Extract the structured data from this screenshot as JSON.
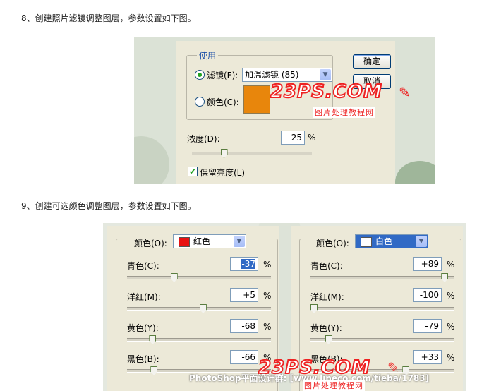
{
  "step8": {
    "text": "8、创建照片滤镜调整图层，参数设置如下图。",
    "group_label": "使用",
    "filter_label": "滤镜(F):",
    "filter_value": "加温滤镜 (85)",
    "color_label": "颜色(C):",
    "ok_label": "确定",
    "cancel_label": "取消",
    "density_label": "浓度(D):",
    "density_value": "25",
    "density_unit": "%",
    "density_level": 25,
    "preserve_label": "保留亮度(L)",
    "preserve_checked": true,
    "swatch_color": "#e8860c"
  },
  "step9": {
    "text": "9、创建可选颜色调整图层，参数设置如下图。",
    "left_panel": {
      "color_label": "颜色(O):",
      "color_value": "红色",
      "swatch_color": "#e81212",
      "rows": [
        {
          "label": "青色(C):",
          "value": "-37",
          "unit": "%",
          "level": -37
        },
        {
          "label": "洋红(M):",
          "value": "+5",
          "unit": "%",
          "level": 5
        },
        {
          "label": "黄色(Y):",
          "value": "-68",
          "unit": "%",
          "level": -68
        },
        {
          "label": "黑色(B):",
          "value": "-66",
          "unit": "%",
          "level": -66
        }
      ]
    },
    "right_panel": {
      "color_label": "颜色(O):",
      "color_value": "白色",
      "swatch_color": "#ffffff",
      "rows": [
        {
          "label": "青色(C):",
          "value": "+89",
          "unit": "%",
          "level": 89
        },
        {
          "label": "洋红(M):",
          "value": "-100",
          "unit": "%",
          "level": -100
        },
        {
          "label": "黄色(Y):",
          "value": "-79",
          "unit": "%",
          "level": -79
        },
        {
          "label": "黑色(B):",
          "value": "+33",
          "unit": "%",
          "level": 33
        }
      ]
    }
  },
  "watermark": {
    "logo": "23PS.COM",
    "subtitle": "图片处理教程网",
    "footer": "PhotoShop平面设计群: [www.lineco.com/tieba/1783]"
  },
  "colors": {
    "accent_red": "#e22222",
    "dialog_bg": "#ece9d8",
    "legend_blue": "#1a4fa8"
  }
}
